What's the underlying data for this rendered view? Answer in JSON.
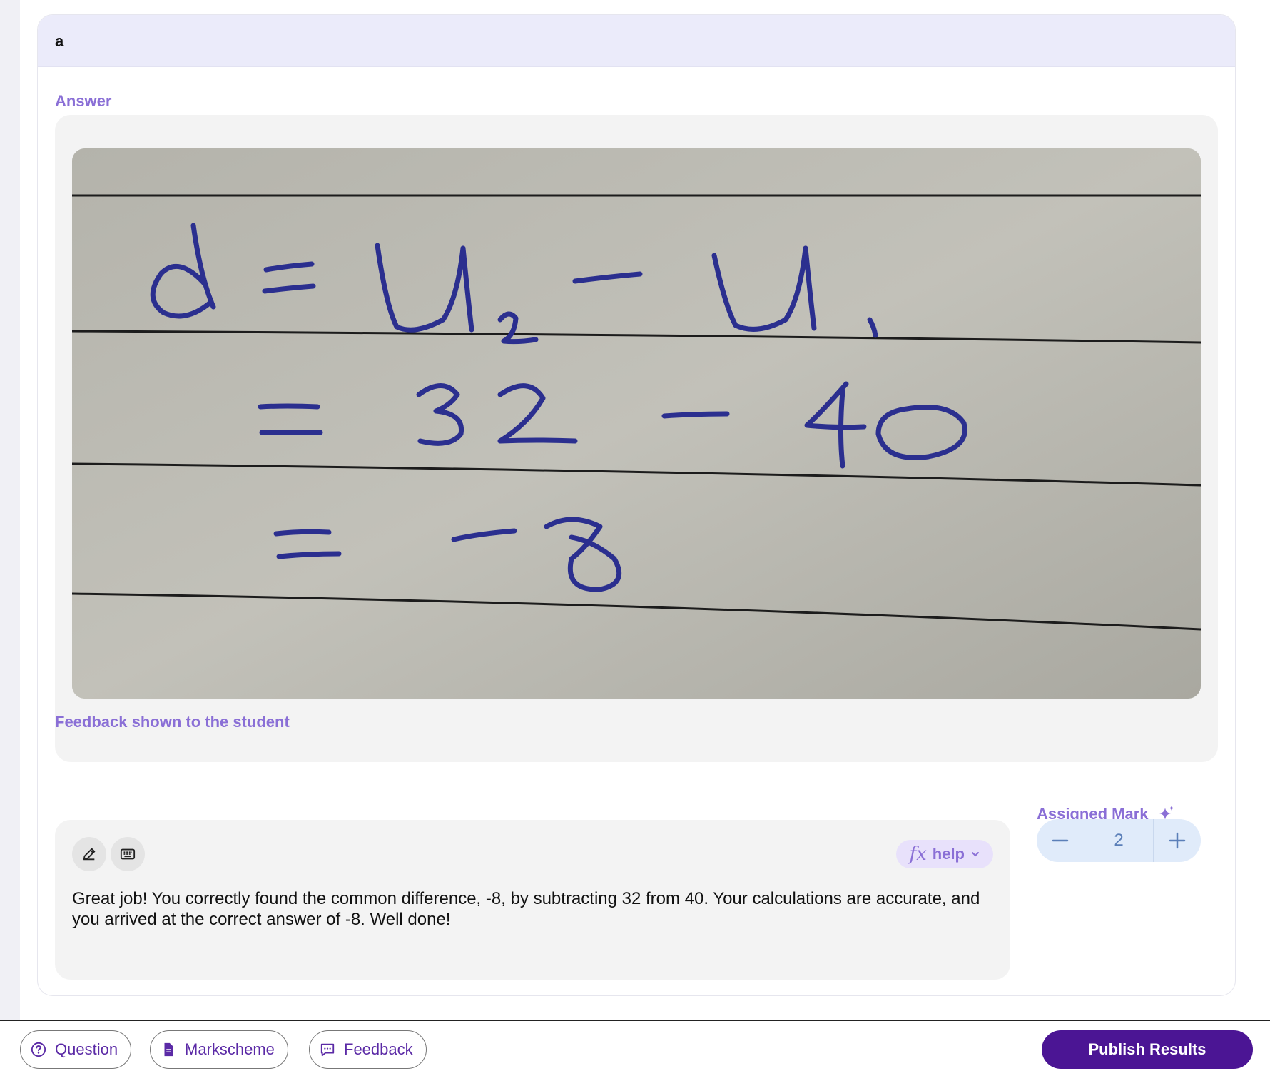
{
  "part": {
    "label": "a"
  },
  "answer": {
    "section_label": "Answer"
  },
  "feedback": {
    "section_label": "Feedback shown to the student",
    "tools": [
      "pen-icon",
      "keyboard-icon"
    ],
    "fx_symbol": "fx",
    "help_label": "help",
    "text": "Great job! You correctly found the common difference, -8, by subtracting 32 from 40. Your calculations are accurate, and you arrived at the correct answer of -8. Well done!"
  },
  "mark": {
    "label": "Assigned Mark",
    "icon": "sparkle-icon",
    "value": "2",
    "decrement_icon": "minus-icon",
    "increment_icon": "plus-icon"
  },
  "bottom_bar": {
    "question_label": "Question",
    "markscheme_label": "Markscheme",
    "feedback_label": "Feedback",
    "publish_label": "Publish Results"
  },
  "colors": {
    "accent": "#8a6fd6",
    "publish": "#4b1594",
    "ink": "#2b2f8f",
    "paper": "#bdbcb4"
  }
}
